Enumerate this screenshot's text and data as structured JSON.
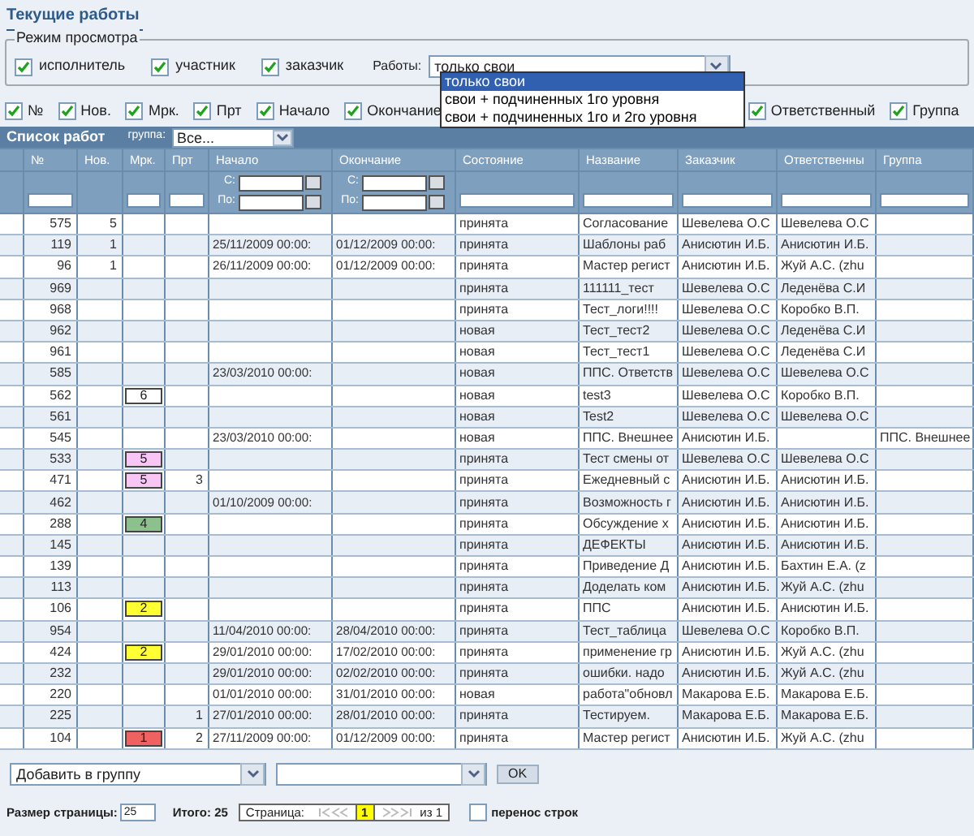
{
  "title": "Текущие работы",
  "view_mode": {
    "legend": "Режим просмотра",
    "checkboxes": [
      {
        "label": "исполнитель",
        "checked": true
      },
      {
        "label": "участник",
        "checked": true
      },
      {
        "label": "заказчик",
        "checked": true
      }
    ],
    "works_label": "Работы:",
    "works_select": {
      "value": "только свои",
      "expanded": true,
      "options": [
        {
          "label": "только свои",
          "selected": true
        },
        {
          "label": "свои + подчиненных 1го уровня",
          "selected": false
        },
        {
          "label": "свои + подчиненных 1го и 2го уровня",
          "selected": false
        }
      ]
    }
  },
  "column_toggles_left": [
    {
      "label": "№",
      "checked": true
    },
    {
      "label": "Нов.",
      "checked": true
    },
    {
      "label": "Мрк.",
      "checked": true
    },
    {
      "label": "Прт",
      "checked": true
    },
    {
      "label": "Начало",
      "checked": true
    },
    {
      "label": "Окончание",
      "checked": true
    }
  ],
  "column_toggles_right": [
    {
      "label": "Ответственный",
      "checked": true
    },
    {
      "label": "Группа",
      "checked": true
    }
  ],
  "table": {
    "title": "Список работ",
    "group_label": "группа:",
    "group_value": "Все...",
    "columns": [
      {
        "label": "№",
        "kind": "text"
      },
      {
        "label": "Нов.",
        "kind": "none"
      },
      {
        "label": "Мрк.",
        "kind": "text"
      },
      {
        "label": "Прт",
        "kind": "text"
      },
      {
        "label": "Начало",
        "kind": "date",
        "from_label": "С:",
        "to_label": "По:"
      },
      {
        "label": "Окончание",
        "kind": "date",
        "from_label": "С:",
        "to_label": "По:"
      },
      {
        "label": "Состояние",
        "kind": "text"
      },
      {
        "label": "Название",
        "kind": "text"
      },
      {
        "label": "Заказчик",
        "kind": "text"
      },
      {
        "label": "Ответственны",
        "kind": "text"
      },
      {
        "label": "Группа",
        "kind": "text"
      }
    ],
    "rows": [
      {
        "number": "575",
        "new": "5",
        "state": "принята",
        "name": "Согласование",
        "customer": "Шевелева О.С",
        "responsible": "Шевелева О.С"
      },
      {
        "number": "119",
        "new": "1",
        "start": "25/11/2009 00:00:",
        "end": "01/12/2009 00:00:",
        "state": "принята",
        "name": "Шаблоны раб",
        "customer": "Анисютин И.Б.",
        "responsible": "Анисютин И.Б."
      },
      {
        "number": "96",
        "new": "1",
        "start": "26/11/2009 00:00:",
        "end": "01/12/2009 00:00:",
        "state": "принята",
        "name": "Мастер регист",
        "customer": "Анисютин И.Б.",
        "responsible": "Жуй А.С. (zhu"
      },
      {
        "number": "969",
        "state": "принята",
        "name": "111111_тест",
        "customer": "Шевелева О.С",
        "responsible": "Леденёва С.И"
      },
      {
        "number": "968",
        "state": "принята",
        "name": "Тест_логи!!!!",
        "customer": "Шевелева О.С",
        "responsible": "Коробко В.П."
      },
      {
        "number": "962",
        "state": "новая",
        "name": "Тест_тест2",
        "customer": "Шевелева О.С",
        "responsible": "Леденёва С.И"
      },
      {
        "number": "961",
        "state": "новая",
        "name": "Тест_тест1",
        "customer": "Шевелева О.С",
        "responsible": "Леденёва С.И"
      },
      {
        "number": "585",
        "start": "23/03/2010 00:00:",
        "state": "новая",
        "name": "ППС. Ответств",
        "customer": "Шевелева О.С",
        "responsible": "Шевелева О.С"
      },
      {
        "number": "562",
        "mark": {
          "text": "6",
          "color": "#ffffff"
        },
        "state": "новая",
        "name": "test3",
        "customer": "Шевелева О.С",
        "responsible": "Коробко В.П."
      },
      {
        "number": "561",
        "state": "новая",
        "name": "Test2",
        "customer": "Шевелева О.С",
        "responsible": "Шевелева О.С"
      },
      {
        "number": "545",
        "start": "23/03/2010 00:00:",
        "state": "новая",
        "name": "ППС. Внешнее",
        "customer": "Анисютин И.Б.",
        "group": "ППС. Внешнее"
      },
      {
        "number": "533",
        "mark": {
          "text": "5",
          "color": "#f7c6f5"
        },
        "state": "принята",
        "name": "Тест смены от",
        "customer": "Шевелева О.С",
        "responsible": "Шевелева О.С"
      },
      {
        "number": "471",
        "mark": {
          "text": "5",
          "color": "#f7c6f5"
        },
        "prt": "3",
        "state": "принята",
        "name": "Ежедневный с",
        "customer": "Анисютин И.Б.",
        "responsible": "Анисютин И.Б."
      },
      {
        "number": "462",
        "start": "01/10/2009 00:00:",
        "state": "принята",
        "name": "Возможность г",
        "customer": "Анисютин И.Б.",
        "responsible": "Анисютин И.Б."
      },
      {
        "number": "288",
        "mark": {
          "text": "4",
          "color": "#8cc08c"
        },
        "state": "принята",
        "name": "Обсуждение х",
        "customer": "Анисютин И.Б.",
        "responsible": "Анисютин И.Б."
      },
      {
        "number": "145",
        "state": "принята",
        "name": "ДЕФЕКТЫ",
        "customer": "Анисютин И.Б.",
        "responsible": "Анисютин И.Б."
      },
      {
        "number": "139",
        "state": "принята",
        "name": "Приведение Д",
        "customer": "Анисютин И.Б.",
        "responsible": "Бахтин Е.А. (z"
      },
      {
        "number": "113",
        "state": "принята",
        "name": "Доделать ком",
        "customer": "Анисютин И.Б.",
        "responsible": "Жуй А.С. (zhu"
      },
      {
        "number": "106",
        "mark": {
          "text": "2",
          "color": "#ffff33"
        },
        "state": "принята",
        "name": "ППС",
        "customer": "Анисютин И.Б.",
        "responsible": "Анисютин И.Б."
      },
      {
        "number": "954",
        "start": "11/04/2010 00:00:",
        "end": "28/04/2010 00:00:",
        "state": "принята",
        "name": "Тест_таблица",
        "customer": "Шевелева О.С",
        "responsible": "Коробко В.П."
      },
      {
        "number": "424",
        "mark": {
          "text": "2",
          "color": "#ffff33"
        },
        "start": "29/01/2010 00:00:",
        "end": "17/02/2010 00:00:",
        "state": "принята",
        "name": "применение гр",
        "customer": "Анисютин И.Б.",
        "responsible": "Жуй А.С. (zhu"
      },
      {
        "number": "232",
        "start": "29/01/2010 00:00:",
        "end": "02/02/2010 00:00:",
        "state": "принята",
        "name": "ошибки. надо",
        "customer": "Анисютин И.Б.",
        "responsible": "Жуй А.С. (zhu"
      },
      {
        "number": "220",
        "start": "01/01/2010 00:00:",
        "end": "31/01/2010 00:00:",
        "state": "новая",
        "name": "работа\"обновл",
        "customer": "Макарова Е.Б.",
        "responsible": "Макарова Е.Б."
      },
      {
        "number": "225",
        "prt": "1",
        "start": "27/01/2010 00:00:",
        "end": "28/01/2010 00:00:",
        "state": "принята",
        "name": "Тестируем.",
        "customer": "Макарова Е.Б.",
        "responsible": "Макарова Е.Б."
      },
      {
        "number": "104",
        "mark": {
          "text": "1",
          "color": "#f06262"
        },
        "prt": "2",
        "start": "27/11/2009 00:00:",
        "end": "01/12/2009 00:00:",
        "state": "принята",
        "name": "Мастер регист",
        "customer": "Анисютин И.Б.",
        "responsible": "Жуй А.С. (zhu"
      }
    ]
  },
  "actions": {
    "group_action": "Добавить в группу",
    "ok": "OK"
  },
  "footer": {
    "page_size_label": "Размер страницы:",
    "page_size": "25",
    "total": "Итого: 25",
    "page_label": "Страница:",
    "current_page": "1",
    "of_pages": "из 1",
    "wrap_label": "перенос строк",
    "wrap_checked": false
  }
}
